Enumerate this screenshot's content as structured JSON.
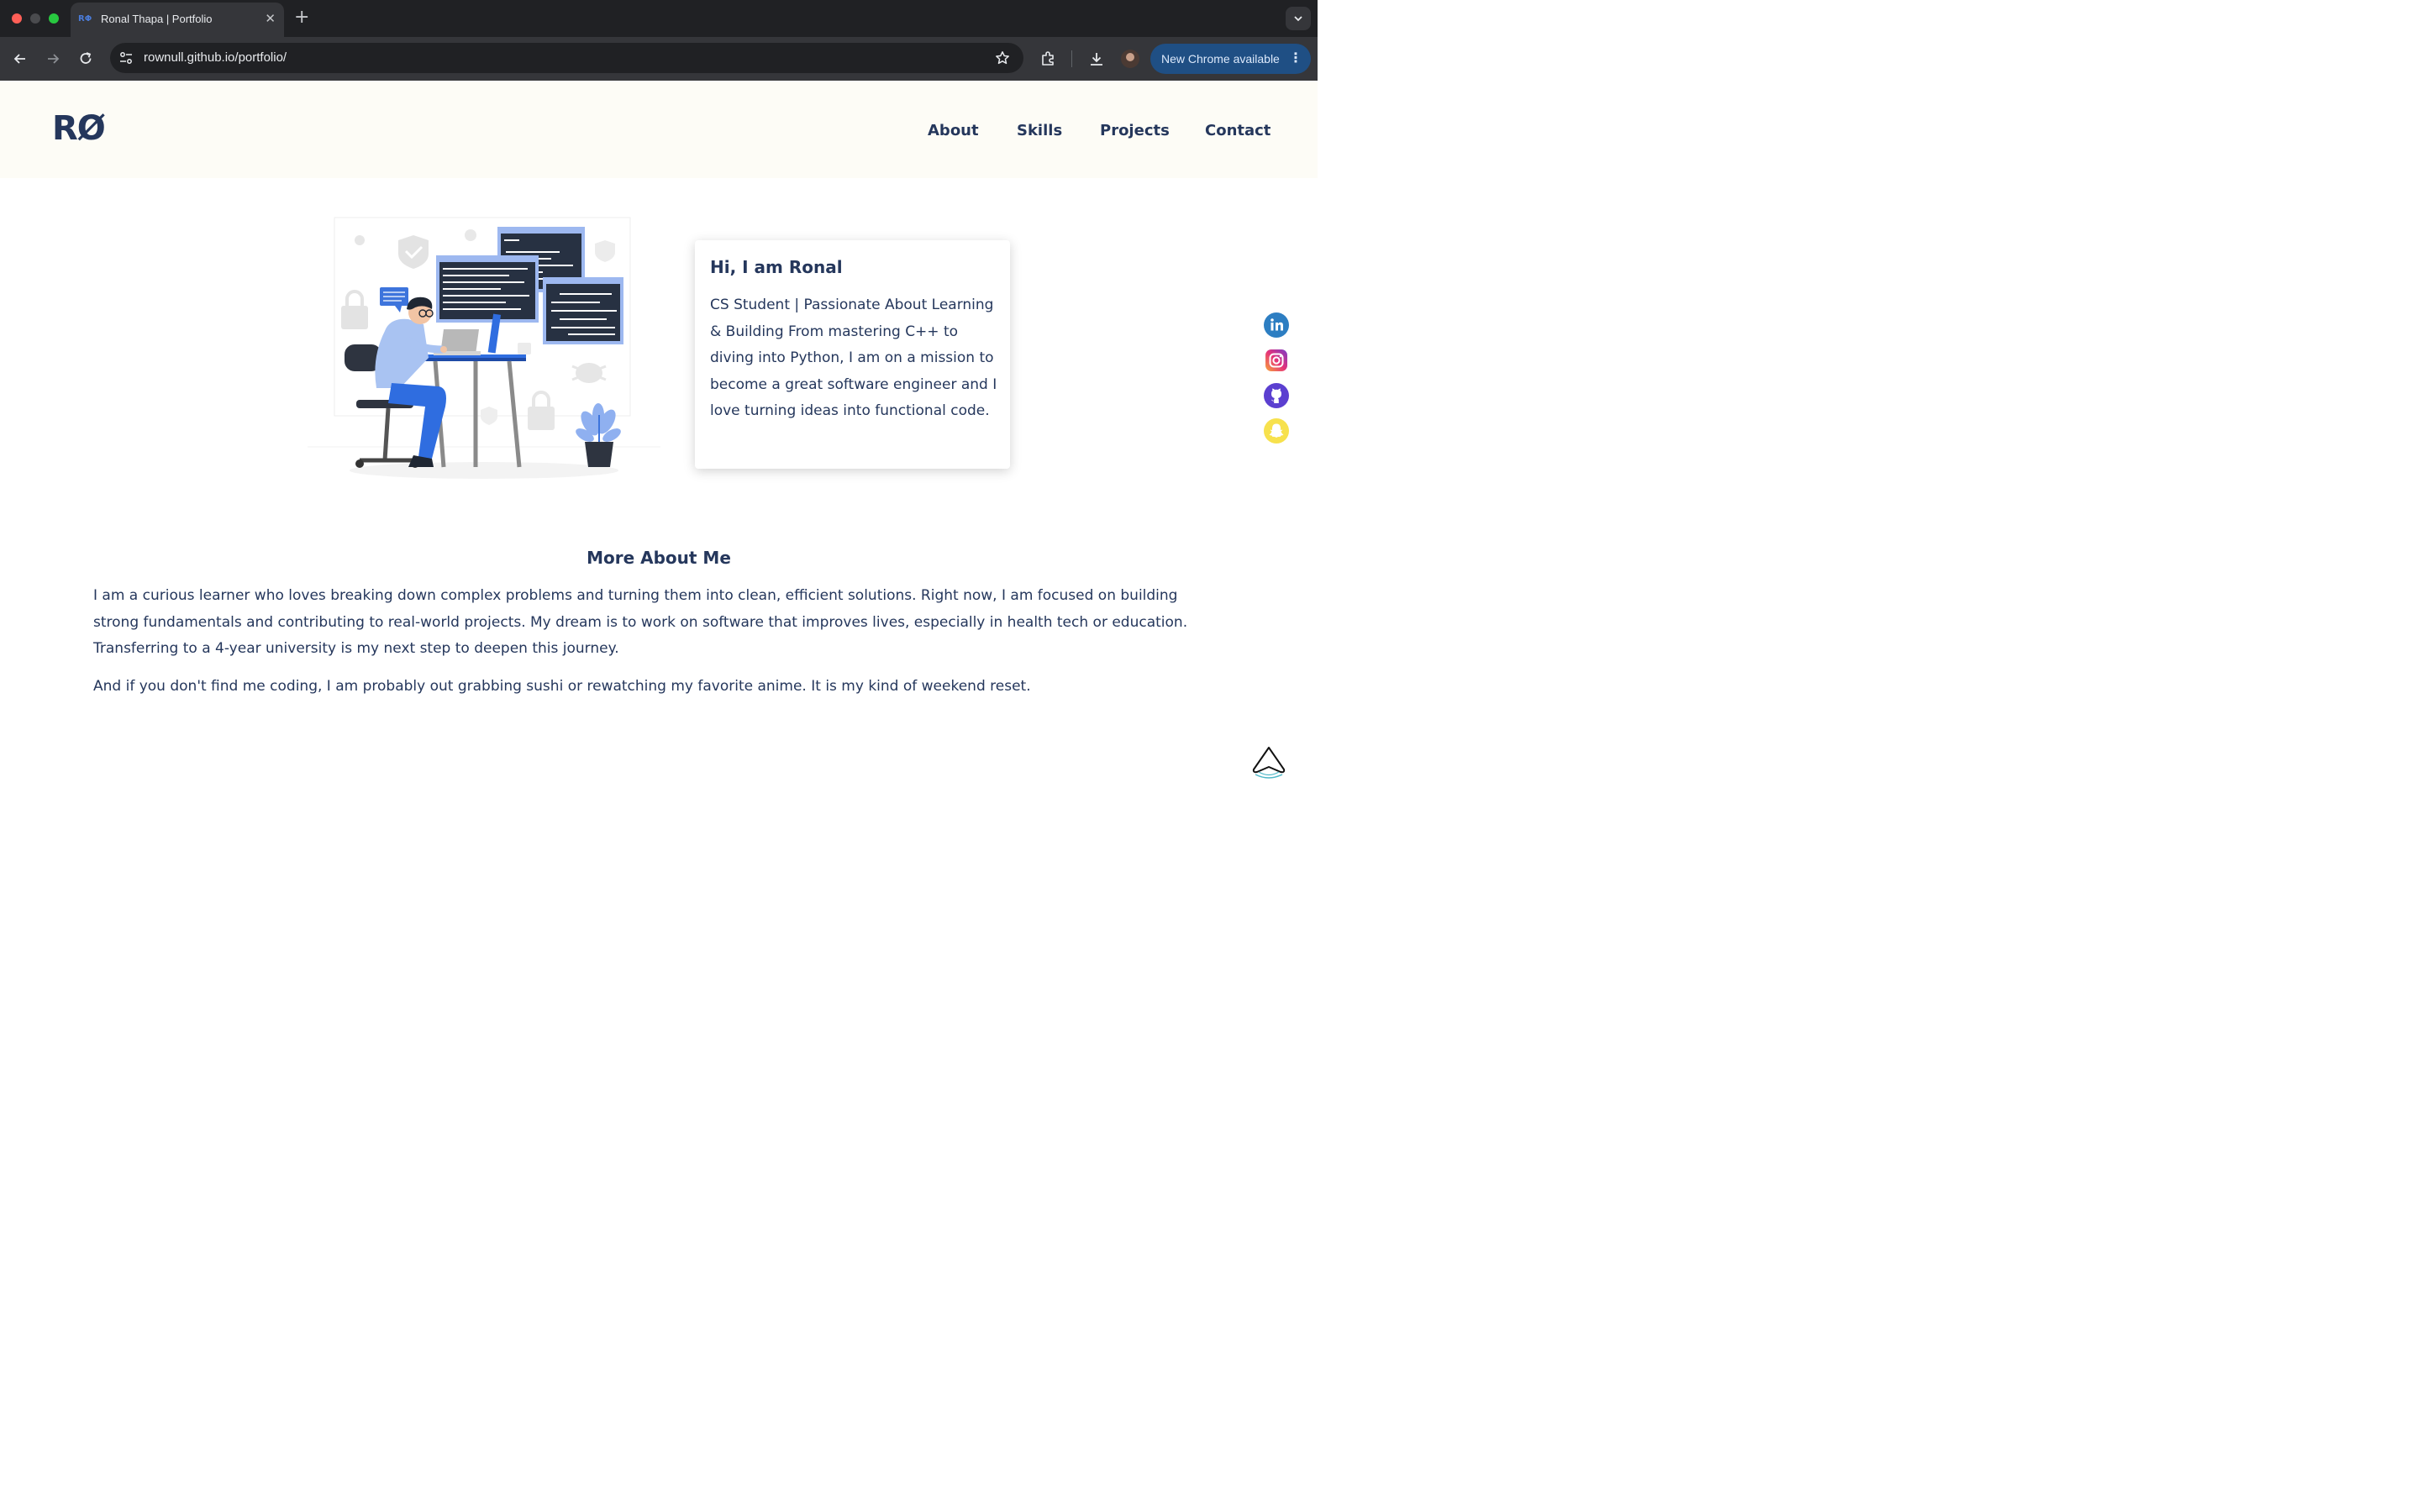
{
  "browser": {
    "tab_title": "Ronal Thapa | Portfolio",
    "tab_favicon_text": "RΦ",
    "url": "rownull.github.io/portfolio/",
    "update_label": "New Chrome available"
  },
  "header": {
    "logo": "RØ",
    "nav": [
      "About",
      "Skills",
      "Projects",
      "Contact"
    ]
  },
  "intro": {
    "greeting": "Hi, I am Ronal",
    "text": "CS Student | Passionate About Learning & Building From mastering C++ to diving into Python, I am on a mission to become a great software engineer and I love turning ideas into functional code."
  },
  "social": [
    "linkedin-icon",
    "instagram-icon",
    "github-icon",
    "snapchat-icon"
  ],
  "more_about": {
    "title": "More About Me",
    "paragraph1": "I am a curious learner who loves breaking down complex problems and turning them into clean, efficient solutions. Right now, I am focused on building strong fundamentals and contributing to real-world projects. My dream is to work on software that improves lives, especially in health tech or education. Transferring to a 4-year university is my next step to deepen this journey.",
    "paragraph2": "And if you don't find me coding, I am probably out grabbing sushi or rewatching my favorite anime. It is my kind of weekend reset."
  },
  "colors": {
    "text": "#25375c",
    "header_bg": "#fdfcf6",
    "accent_blue": "#4a7bd8"
  }
}
